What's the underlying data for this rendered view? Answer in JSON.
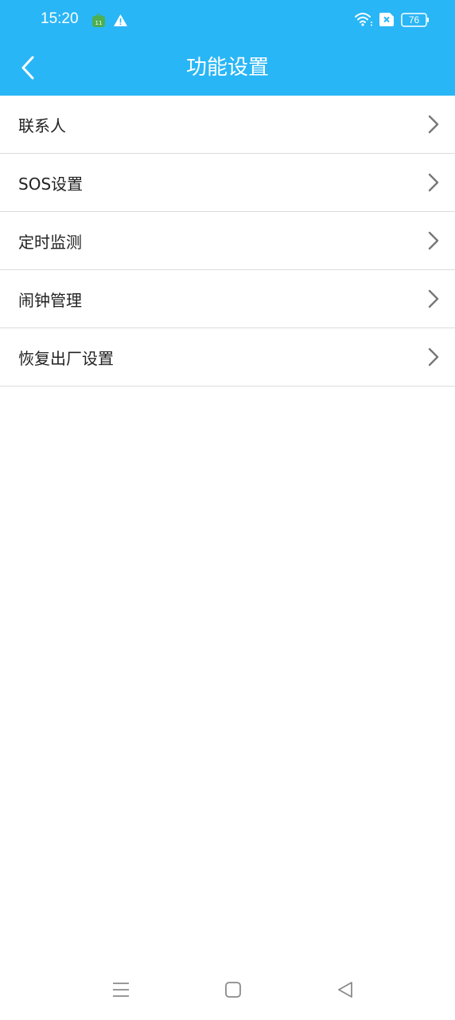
{
  "status_bar": {
    "time": "15:20",
    "battery_level": "76",
    "icons": [
      "app-notification-icon",
      "warning-icon",
      "wifi-icon",
      "sim-x-icon",
      "battery-icon"
    ]
  },
  "app_bar": {
    "title": "功能设置",
    "back_icon": "chevron-left-icon"
  },
  "settings": {
    "items": [
      {
        "label": "联系人"
      },
      {
        "label": "SOS设置"
      },
      {
        "label": "定时监测"
      },
      {
        "label": "闹钟管理"
      },
      {
        "label": "恢复出厂设置"
      }
    ]
  },
  "nav_bar": {
    "icons": [
      "menu-icon",
      "home-icon",
      "back-triangle-icon"
    ]
  },
  "colors": {
    "primary": "#29b6f6",
    "divider": "#dcdcdc",
    "text": "#222222",
    "chevron": "#777777"
  }
}
